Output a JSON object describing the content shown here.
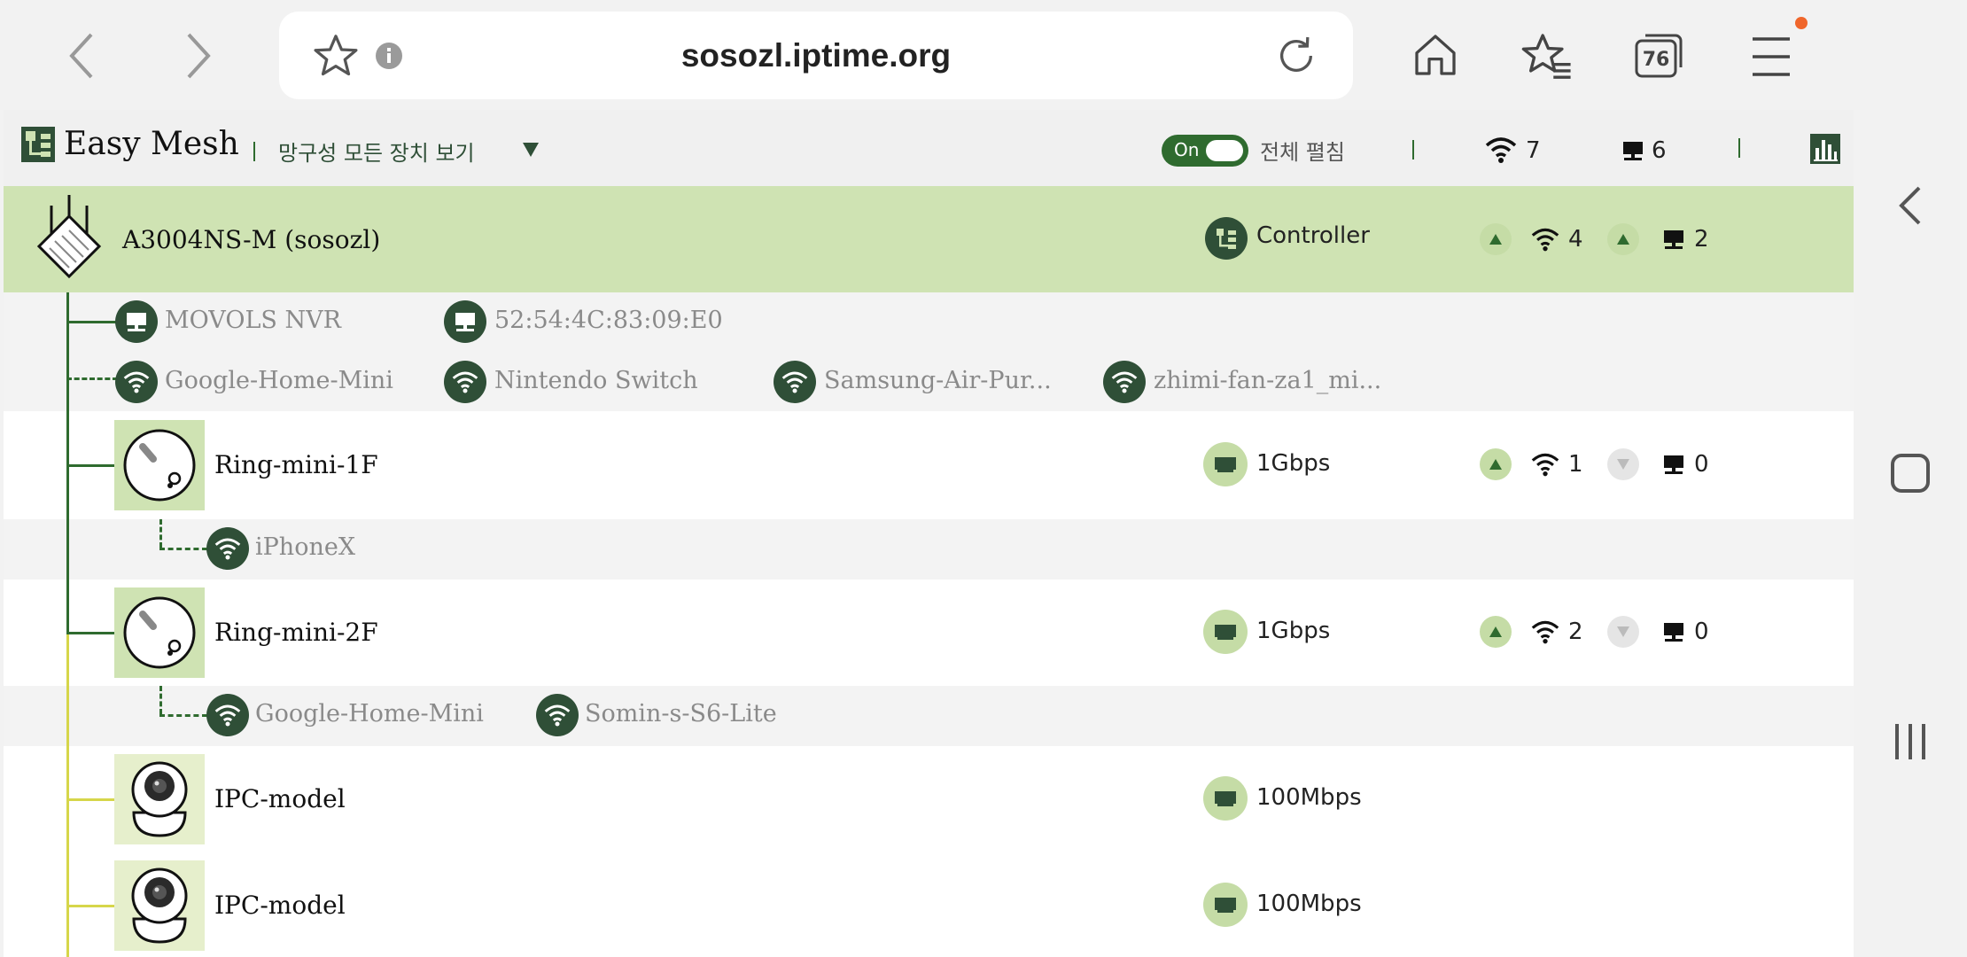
{
  "browser": {
    "url": "sosozl.iptime.org",
    "tab_count": "76"
  },
  "app": {
    "title": "Easy Mesh",
    "view_selector": "망구성 모든 장치 보기",
    "toggle_label": "On",
    "expand_all_label": "전체 펼침",
    "total_wifi": "7",
    "total_wired": "6"
  },
  "controller": {
    "model": "A3004NS-M",
    "name": "(sosozl)",
    "role": "Controller",
    "wifi_count": "4",
    "wired_count": "2",
    "wired_clients": [
      "MOVOLS NVR",
      "52:54:4C:83:09:E0"
    ],
    "wifi_clients": [
      "Google-Home-Mini",
      "Nintendo Switch",
      "Samsung-Air-Pur...",
      "zhimi-fan-za1_mi..."
    ]
  },
  "nodes": [
    {
      "name": "Ring-mini-1F",
      "link": "1Gbps",
      "wifi_count": "1",
      "wired_count": "0",
      "wifi_clients": [
        "iPhoneX"
      ]
    },
    {
      "name": "Ring-mini-2F",
      "link": "1Gbps",
      "wifi_count": "2",
      "wired_count": "0",
      "wifi_clients": [
        "Google-Home-Mini",
        "Somin-s-S6-Lite"
      ]
    },
    {
      "name": "IPC-model",
      "link": "100Mbps"
    },
    {
      "name": "IPC-model",
      "link": "100Mbps"
    }
  ],
  "colors": {
    "accent_dark": "#2f4f37",
    "controller_row": "#cfe3b3",
    "tree_line": "#2f6b2f",
    "tree_line_secondary": "#d6d64a"
  }
}
